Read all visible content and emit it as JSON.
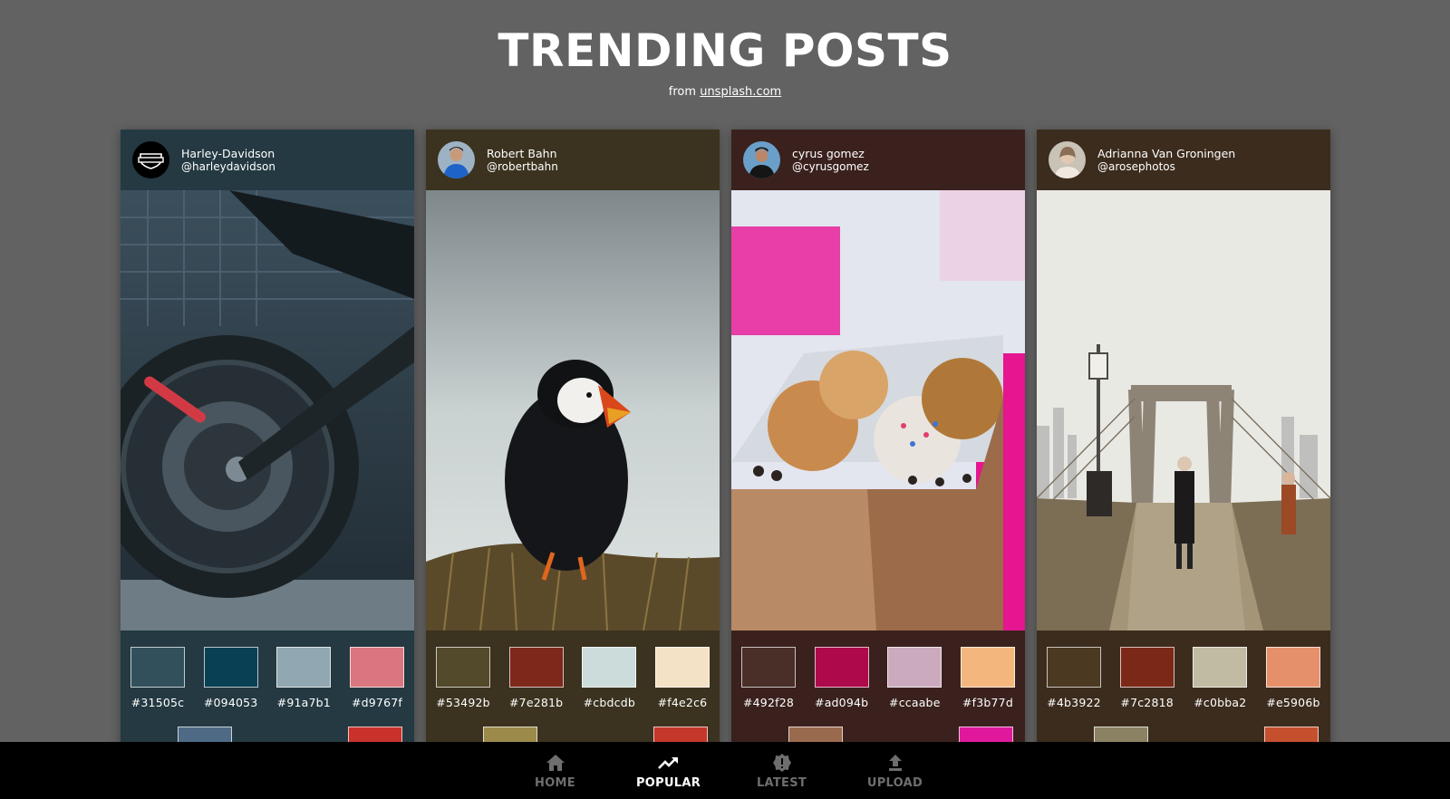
{
  "header": {
    "title": "TRENDING POSTS",
    "from_text": "from",
    "source_link": "unsplash.com"
  },
  "cards": [
    {
      "name": "Harley-Davidson",
      "handle": "@harleydavidson",
      "bg": "#243942",
      "photo": "motorcycle",
      "swatches": [
        "#31505c",
        "#094053",
        "#91a7b1",
        "#d9767f"
      ],
      "extra_swatches": [
        "#4e6a85",
        "#c8322a"
      ]
    },
    {
      "name": "Robert Bahn",
      "handle": "@robertbahn",
      "bg": "#3b3220",
      "photo": "puffin",
      "swatches": [
        "#53492b",
        "#7e281b",
        "#cbdcdb",
        "#f4e2c6"
      ],
      "extra_swatches": [
        "#9b8a4a",
        "#c4372a"
      ]
    },
    {
      "name": "cyrus gomez",
      "handle": "@cyrusgomez",
      "bg": "#3a211d",
      "photo": "donuts",
      "swatches": [
        "#492f28",
        "#ad094b",
        "#ccaabe",
        "#f3b77d"
      ],
      "extra_swatches": [
        "#9a6a4e",
        "#e0199c"
      ]
    },
    {
      "name": "Adrianna Van Groningen",
      "handle": "@arosephotos",
      "bg": "#3c2c1d",
      "photo": "bridge",
      "swatches": [
        "#4b3922",
        "#7c2818",
        "#c0bba2",
        "#e5906b"
      ],
      "extra_swatches": [
        "#8a8262",
        "#c5502e"
      ]
    }
  ],
  "nav": [
    {
      "label": "HOME",
      "icon": "home-icon",
      "active": false
    },
    {
      "label": "POPULAR",
      "icon": "trending-icon",
      "active": true
    },
    {
      "label": "LATEST",
      "icon": "badge-icon",
      "active": false
    },
    {
      "label": "UPLOAD",
      "icon": "upload-icon",
      "active": false
    }
  ]
}
